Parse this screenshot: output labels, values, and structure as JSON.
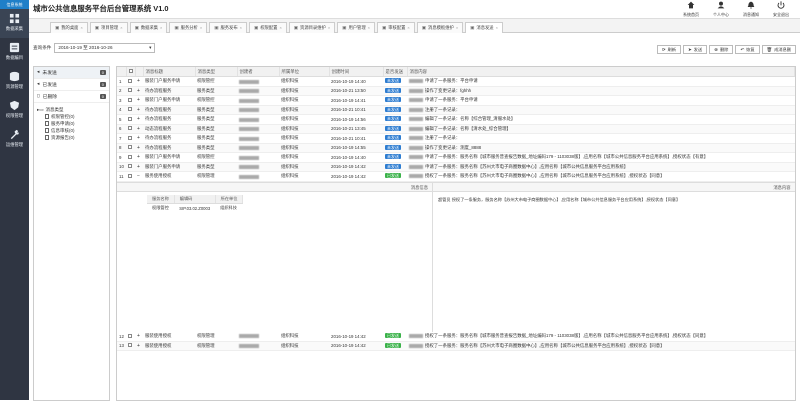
{
  "app": {
    "title": "城市公共信息服务平台后台管理系统 V1.0",
    "sidebar_top": "信息系统"
  },
  "sidebar": [
    {
      "label": "数据采集",
      "icon": "grid-icon"
    },
    {
      "label": "数据编目",
      "icon": "catalog-icon"
    },
    {
      "label": "资源管理",
      "icon": "database-icon"
    },
    {
      "label": "权限管理",
      "icon": "shield-icon"
    },
    {
      "label": "运维管理",
      "icon": "wrench-icon"
    }
  ],
  "top_actions": [
    {
      "label": "系统首页",
      "icon": "home-icon"
    },
    {
      "label": "个人中心",
      "icon": "user-icon"
    },
    {
      "label": "消息通知",
      "icon": "bell-icon"
    },
    {
      "label": "安全退出",
      "icon": "power-icon"
    }
  ],
  "tabs": [
    {
      "label": "我的桌面",
      "icon": "monitor-icon"
    },
    {
      "label": "项目管理",
      "icon": "list-icon"
    },
    {
      "label": "数据采集",
      "icon": "table-icon"
    },
    {
      "label": "服务分析",
      "icon": "chart-icon"
    },
    {
      "label": "服务发布",
      "icon": "doc-icon"
    },
    {
      "label": "权限配置",
      "icon": "grid-icon"
    },
    {
      "label": "资源目录维护",
      "icon": "folder-icon"
    },
    {
      "label": "用户管理",
      "icon": "users-icon"
    },
    {
      "label": "审核配置",
      "icon": "check-icon"
    },
    {
      "label": "消息模板维护",
      "icon": "template-icon"
    },
    {
      "label": "消息发送",
      "icon": "send-icon"
    }
  ],
  "filter": {
    "label": "查询条件",
    "date_range": "2016-10-19 至 2016-10-26"
  },
  "toolbar": [
    {
      "label": "刷新",
      "icon": "refresh-icon"
    },
    {
      "label": "发送",
      "icon": "send-icon"
    },
    {
      "label": "删除",
      "icon": "delete-icon"
    },
    {
      "label": "恢复",
      "icon": "undo-icon"
    },
    {
      "label": "成消息删",
      "icon": "trash-icon"
    }
  ],
  "left_panel": {
    "items": [
      {
        "label": "未发送",
        "count": "0",
        "icon": "arrow-icon"
      },
      {
        "label": "已发送",
        "count": "0",
        "icon": "arrow-icon"
      },
      {
        "label": "已删除",
        "count": "0",
        "icon": "trash-icon"
      }
    ],
    "tree_root": "消息类型",
    "tree": [
      "权限管控(0)",
      "服务申请(0)",
      "信息审核(0)",
      "资源报告(0)"
    ]
  },
  "table": {
    "headers": [
      "",
      "",
      "",
      "消息标题",
      "消息类型",
      "创建者",
      "所属单位",
      "创建时间",
      "是否发送",
      "消息内容"
    ],
    "rows": [
      {
        "n": "1",
        "title": "服装门户服务申请",
        "type": "权限管控",
        "org": "组织科技",
        "time": "2016-10-19 14:40",
        "sent": "未发送",
        "content": "申请了一条服务：平台申请"
      },
      {
        "n": "2",
        "title": "待办流程服务",
        "type": "服务类型",
        "org": "组织科技",
        "time": "2016-10-21 13:50",
        "sent": "未发送",
        "content": "操作了变更记录：fghhh"
      },
      {
        "n": "3",
        "title": "服装门户服务申请",
        "type": "权限管控",
        "org": "组织科技",
        "time": "2016-10-19 14:41",
        "sent": "未发送",
        "content": "申请了一条服务：平台申请"
      },
      {
        "n": "4",
        "title": "待办流程服务",
        "type": "服务类型",
        "org": "组织科技",
        "time": "2016-10-21 10:41",
        "sent": "未发送",
        "content": "注册了一条记录："
      },
      {
        "n": "5",
        "title": "待办流程服务",
        "type": "服务类型",
        "org": "组织科技",
        "time": "2016-10-19 14:56",
        "sent": "未发送",
        "content": "编辑了一条记录：名称【综合管理_清服水处】"
      },
      {
        "n": "6",
        "title": "动态流程服务",
        "type": "服务类型",
        "org": "组织科技",
        "time": "2016-10-21 13:45",
        "sent": "未发送",
        "content": "编辑了一条记录：名称【清水处_综合管理】"
      },
      {
        "n": "7",
        "title": "待办流程服务",
        "type": "服务类型",
        "org": "组织科技",
        "time": "2016-10-21 10:41",
        "sent": "未发送",
        "content": "注册了一条记录："
      },
      {
        "n": "8",
        "title": "待办流程服务",
        "type": "服务类型",
        "org": "组织科技",
        "time": "2016-10-19 14:55",
        "sent": "未发送",
        "content": "操作了变更记录：测度_8888"
      },
      {
        "n": "9",
        "title": "服装门户服务申请",
        "type": "权限管控",
        "org": "组织科技",
        "time": "2016-10-19 14:40",
        "sent": "未发送",
        "content": "申请了一条服务：服务名称【城市服务普查报告数据_地址编码179 - 1103038版】,应用名称【城市公共信息服务平台应用系统】,授权状态【有意】"
      },
      {
        "n": "10",
        "title": "服装门户服务申请",
        "type": "服务类型",
        "org": "组织科技",
        "time": "2016-10-19 14:42",
        "sent": "未发送",
        "content": "申请了一条服务：服务名称【苏州大市电子商圈数据中心】,应用名称【城市公共信息服务平台应用系统】"
      },
      {
        "n": "11",
        "title": "服务使用授权",
        "type": "权限管理",
        "org": "组织科技",
        "time": "2016-10-19 14:42",
        "sent": "已发送",
        "content": "授权了一条服务：服务名称【苏州大市电子商圈数据中心】,应用名称【城市公共信息服务平台应用系统】,授权状态【同意】"
      }
    ],
    "after_rows": [
      {
        "n": "12",
        "title": "服装使用授权",
        "type": "权限管理",
        "org": "组织科技",
        "time": "2016-10-19 14:42",
        "sent": "已发送",
        "content": "授权了一条服务：服务名称【城市服务普查报告数据_地址编码179 - 1103038版】,应用名称【城市公共信息服务平台应用系统】,授权状态【同意】"
      },
      {
        "n": "13",
        "title": "服装使用授权",
        "type": "权限管理",
        "org": "组织科技",
        "time": "2016-10-19 14:42",
        "sent": "已发送",
        "content": "授权了一条服务：服务名称【苏州大市电子商圈数据中心】,应用名称【城市公共信息服务平台应用系统】,授权状态【同意】"
      }
    ]
  },
  "detail": {
    "left_title": "消息信息",
    "right_title": "消息内容",
    "sub_headers": [
      "服务名称",
      "编辑码",
      "所在单位"
    ],
    "sub_row": [
      "权限管控",
      "SIP.03.02.Z0003",
      "组织科技"
    ],
    "message": "超管员 授权了一条服务，服务名称【苏州大市电子商圈数据中心】,应用名称【城市公共信息服务平台应用系统】,授权状态【同意】"
  }
}
